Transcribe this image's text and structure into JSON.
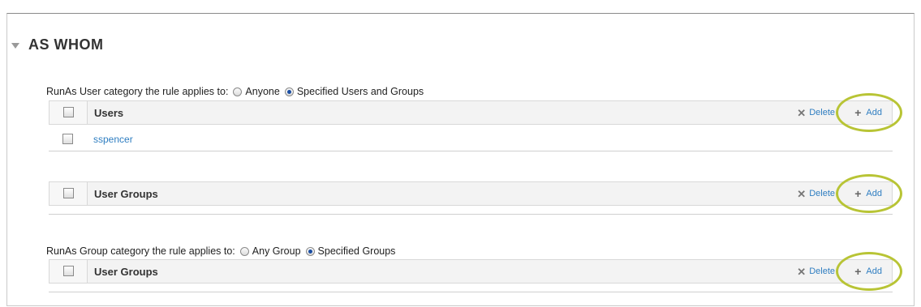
{
  "section": {
    "title": "AS WHOM"
  },
  "runas_user": {
    "label": "RunAs User category the rule applies to:",
    "options": [
      {
        "label": "Anyone",
        "selected": false
      },
      {
        "label": "Specified Users and Groups",
        "selected": true
      }
    ]
  },
  "users_table": {
    "header": "Users",
    "delete_label": "Delete",
    "add_label": "Add",
    "rows": [
      "sspencer"
    ]
  },
  "user_groups_table": {
    "header": "User Groups",
    "delete_label": "Delete",
    "add_label": "Add"
  },
  "runas_group": {
    "label": "RunAs Group category the rule applies to:",
    "options": [
      {
        "label": "Any Group",
        "selected": false
      },
      {
        "label": "Specified Groups",
        "selected": true
      }
    ]
  },
  "group_table": {
    "header": "User Groups",
    "delete_label": "Delete",
    "add_label": "Add"
  },
  "colors": {
    "link": "#2f7ec1",
    "highlight_circle": "#b8c435"
  }
}
